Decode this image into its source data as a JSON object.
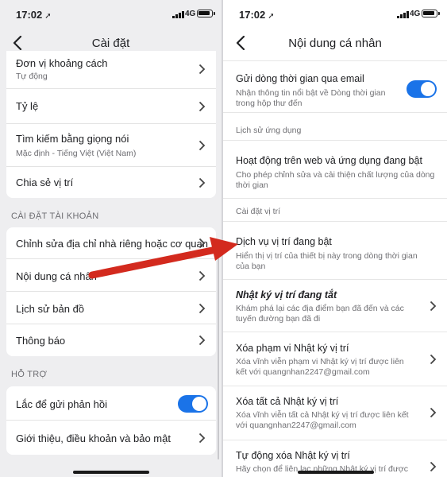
{
  "left": {
    "status": {
      "time": "17:02",
      "network": "4G"
    },
    "title": "Cài đặt",
    "top_items": [
      {
        "label": "Đơn vị khoảng cách",
        "sub": "Tự động"
      },
      {
        "label": "Tỷ lệ"
      },
      {
        "label": "Tìm kiếm bằng giọng nói",
        "sub": "Mặc định - Tiếng Việt (Việt Nam)"
      },
      {
        "label": "Chia sẻ vị trí"
      }
    ],
    "account_header": "CÀI ĐẶT TÀI KHOẢN",
    "account_items": [
      {
        "label": "Chỉnh sửa địa chỉ nhà riêng hoặc cơ quan"
      },
      {
        "label": "Nội dung cá nhân"
      },
      {
        "label": "Lịch sử bản đồ"
      },
      {
        "label": "Thông báo"
      }
    ],
    "support_header": "HỖ TRỢ",
    "support_items": [
      {
        "label": "Lắc để gửi phản hồi",
        "toggle_on": true
      },
      {
        "label": "Giới thiệu, điều khoản và bảo mật"
      }
    ]
  },
  "right": {
    "status": {
      "time": "17:02",
      "network": "4G"
    },
    "title": "Nội dung cá nhân",
    "timeline_email": {
      "label": "Gửi dòng thời gian qua email",
      "desc": "Nhận thông tin nổi bật về Dòng thời gian trong hộp thư đến",
      "toggle_on": true
    },
    "app_history_header": "Lịch sử ứng dụng",
    "web_app_activity": {
      "label": "Hoạt động trên web và ứng dụng đang bật",
      "desc": "Cho phép chỉnh sửa và cải thiện chất lượng của dòng thời gian"
    },
    "location_header": "Cài đặt vị trí",
    "location_services": {
      "label": "Dịch vụ vị trí đang bật",
      "desc": "Hiển thị vị trí của thiết bị này trong dòng thời gian của bạn"
    },
    "location_history": {
      "label": "Nhật ký vị trí đang tắt",
      "desc": "Khám phá lại các địa điểm bạn đã đến và các tuyến đường bạn đã đi"
    },
    "delete_range": {
      "label": "Xóa phạm vi Nhật ký vị trí",
      "desc": "Xóa vĩnh viễn phạm vi Nhật ký vị trí được liên kết với quangnhan2247@gmail.com"
    },
    "delete_all": {
      "label": "Xóa tất cả Nhật ký vị trí",
      "desc": "Xóa vĩnh viễn tất cả Nhật ký vị trí được liên kết với quangnhan2247@gmail.com"
    },
    "auto_delete": {
      "label": "Tự động xóa Nhật ký vị trí",
      "desc": "Hãy chọn để liên lạc những Nhật ký vị trí được"
    }
  },
  "colors": {
    "accent": "#1a73e8",
    "arrow": "#d32a1e"
  }
}
